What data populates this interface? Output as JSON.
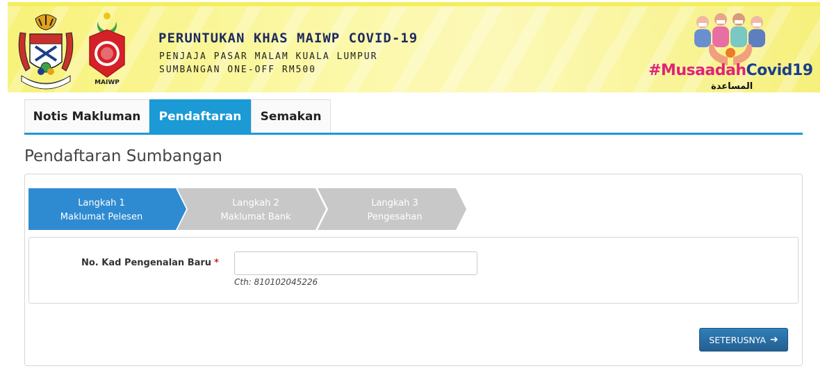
{
  "banner": {
    "title": "PERUNTUKAN KHAS MAIWP COVID-19",
    "subtitle_line1": "PENJAJA PASAR MALAM KUALA LUMPUR",
    "subtitle_line2": "SUMBANGAN ONE-OFF RM500",
    "maiwp_caption": "MAIWP",
    "hashtag_part1": "#Musaadah",
    "hashtag_part2": "Covid19",
    "arabic_text": "المساعدة"
  },
  "tabs": [
    {
      "label": "Notis Makluman",
      "active": false
    },
    {
      "label": "Pendaftaran",
      "active": true
    },
    {
      "label": "Semakan",
      "active": false
    }
  ],
  "page": {
    "heading": "Pendaftaran Sumbangan"
  },
  "wizard": {
    "steps": [
      {
        "line1": "Langkah 1",
        "line2": "Maklumat Pelesen",
        "active": true
      },
      {
        "line1": "Langkah 2",
        "line2": "Maklumat Bank",
        "active": false
      },
      {
        "line1": "Langkah 3",
        "line2": "Pengesahan",
        "active": false
      }
    ]
  },
  "form": {
    "ic_label": "No. Kad Pengenalan Baru",
    "required_mark": "*",
    "ic_value": "",
    "ic_placeholder": "",
    "ic_hint": "Cth: 810102045226"
  },
  "actions": {
    "next_label": "SETERUSNYA",
    "next_icon": "arrow-right-icon"
  },
  "colors": {
    "tab_active": "#1b9ad6",
    "step_active": "#2f8bd1",
    "step_inactive": "#c8c8c8",
    "button": "#2a6fa6",
    "required": "#d9232d"
  }
}
